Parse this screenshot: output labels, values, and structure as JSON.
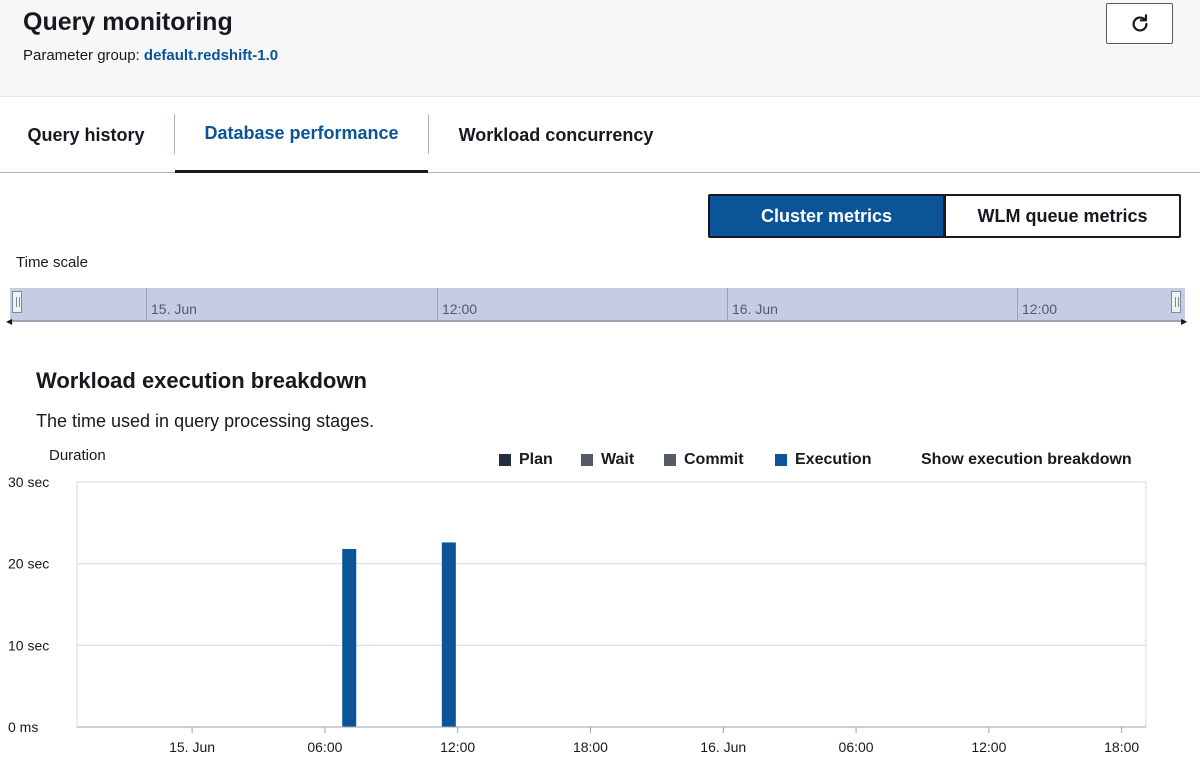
{
  "header": {
    "title": "Query monitoring",
    "param_label": "Parameter group: ",
    "param_value": "default.redshift-1.0",
    "refresh_icon": "refresh-icon"
  },
  "tabs": [
    {
      "label": "Query history",
      "active": false
    },
    {
      "label": "Database performance",
      "active": true
    },
    {
      "label": "Workload concurrency",
      "active": false
    }
  ],
  "metrics_toggle": {
    "selected": "Cluster metrics",
    "other": "WLM queue metrics"
  },
  "timescale": {
    "label": "Time scale",
    "ticks": [
      "15. Jun",
      "12:00",
      "16. Jun",
      "12:00"
    ]
  },
  "section": {
    "title": "Workload execution breakdown",
    "description": "The time used in query processing stages."
  },
  "colors": {
    "accent": "#0a5497",
    "plan": "#232f3e",
    "wait": "#545b64",
    "commit": "#545b64",
    "execution": "#0a5497",
    "grid": "#d5dbdb"
  },
  "chart_data": {
    "type": "bar",
    "ylabel": "Duration",
    "ylim": [
      0,
      30
    ],
    "y_ticks": [
      "30 sec",
      "20 sec",
      "10 sec",
      "0 ms"
    ],
    "y_tick_values": [
      30,
      20,
      10,
      0
    ],
    "x_ticks": [
      "15. Jun",
      "06:00",
      "12:00",
      "18:00",
      "16. Jun",
      "06:00",
      "12:00",
      "18:00"
    ],
    "x_tick_hours": [
      0,
      6,
      12,
      18,
      24,
      30,
      36,
      42
    ],
    "x_range_hours": [
      -5.2,
      43.1
    ],
    "legend": [
      "Plan",
      "Wait",
      "Commit",
      "Execution"
    ],
    "series": [
      {
        "name": "Execution",
        "x_hours": [
          7.1,
          11.6
        ],
        "values": [
          21.8,
          22.6
        ]
      }
    ],
    "toggle_label": "Show execution breakdown",
    "grid": true
  }
}
